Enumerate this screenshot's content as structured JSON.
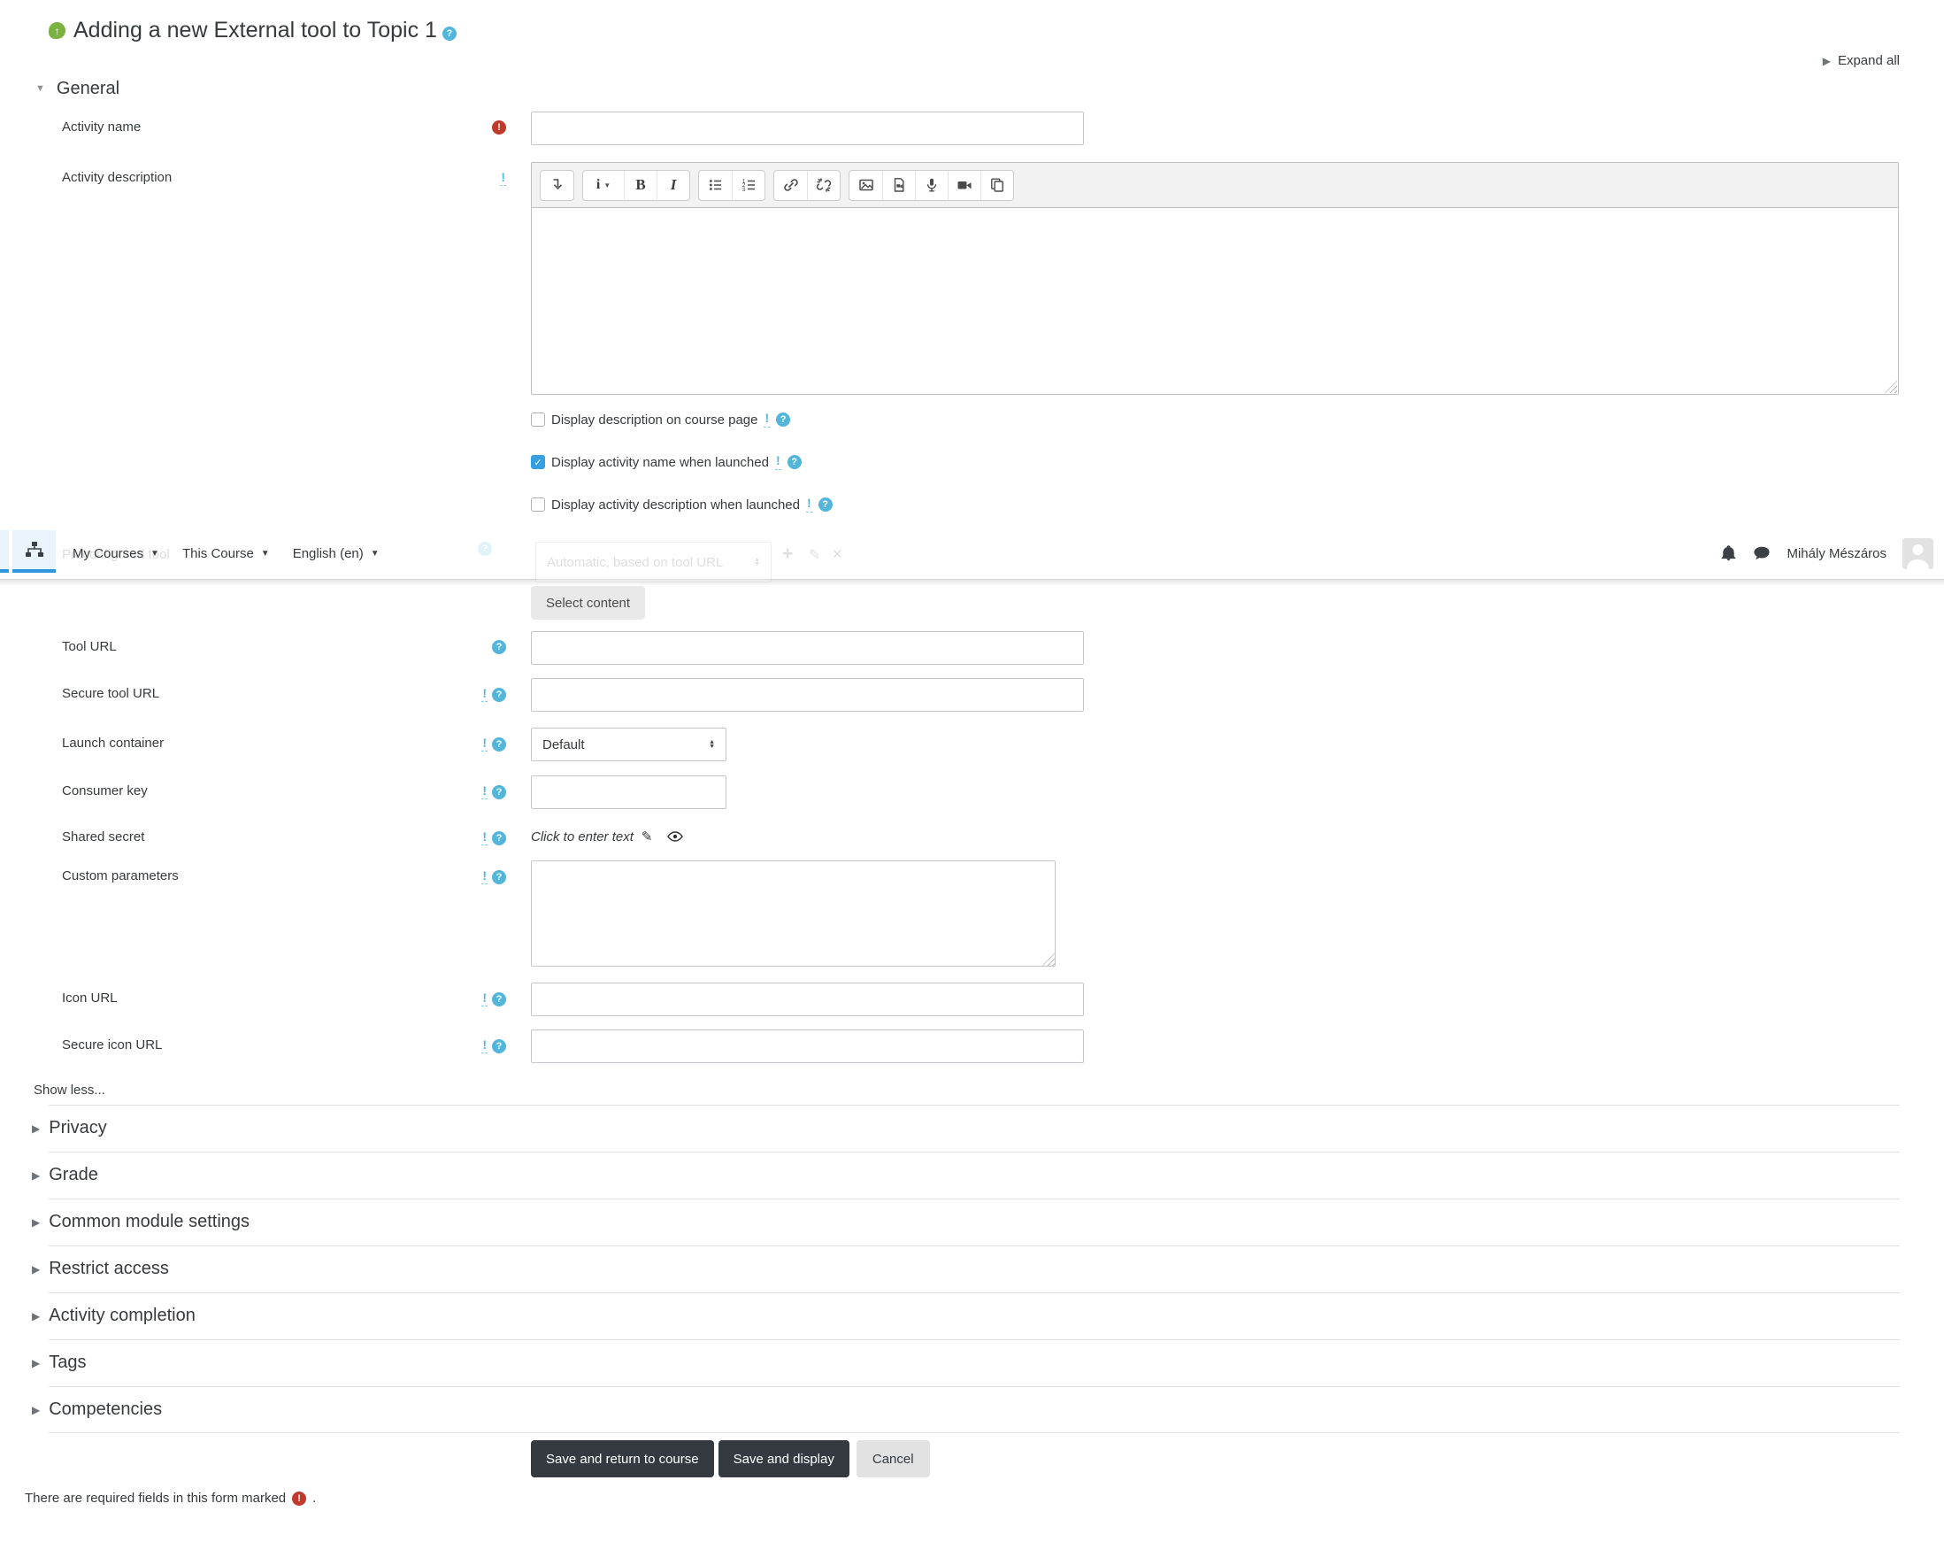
{
  "page": {
    "title": "Adding a new External tool to Topic 1",
    "expand_all": "Expand all",
    "footer_note": "There are required fields in this form marked",
    "footer_note_suffix": "."
  },
  "navbar": {
    "menus": [
      {
        "label": "My Courses"
      },
      {
        "label": "This Course"
      },
      {
        "label": "English (en)"
      }
    ],
    "user_name": "Mihály Mészáros",
    "icons": [
      "sitemap-icon",
      "bell-icon",
      "messages-icon",
      "avatar"
    ]
  },
  "ghost_row": {
    "label": "Preconfigured tool",
    "select_value": "Automatic, based on tool URL",
    "icons": [
      "add-icon",
      "edit-icon",
      "delete-icon"
    ]
  },
  "sections": {
    "general": "General",
    "collapsed": [
      "Privacy",
      "Grade",
      "Common module settings",
      "Restrict access",
      "Activity completion",
      "Tags",
      "Competencies"
    ]
  },
  "fields": {
    "activity_name": {
      "label": "Activity name",
      "value": ""
    },
    "activity_description": {
      "label": "Activity description",
      "value": ""
    },
    "select_content": "Select content",
    "tool_url": {
      "label": "Tool URL",
      "value": ""
    },
    "secure_tool_url": {
      "label": "Secure tool URL",
      "value": ""
    },
    "launch_container": {
      "label": "Launch container",
      "value": "Default"
    },
    "consumer_key": {
      "label": "Consumer key",
      "value": ""
    },
    "shared_secret": {
      "label": "Shared secret",
      "value": "Click to enter text"
    },
    "custom_parameters": {
      "label": "Custom parameters",
      "value": ""
    },
    "icon_url": {
      "label": "Icon URL",
      "value": ""
    },
    "secure_icon_url": {
      "label": "Secure icon URL",
      "value": ""
    },
    "show_less": "Show less..."
  },
  "checkboxes": [
    {
      "label": "Display description on course page",
      "checked": false
    },
    {
      "label": "Display activity name when launched",
      "checked": true
    },
    {
      "label": "Display activity description when launched",
      "checked": false
    }
  ],
  "editor_toolbar": [
    "collapse-toolbar",
    "paragraph-styles",
    "bold",
    "italic",
    "unordered-list",
    "ordered-list",
    "link",
    "unlink",
    "insert-image",
    "insert-media",
    "record-audio",
    "record-video",
    "manage-files"
  ],
  "buttons": {
    "save_return": "Save and return to course",
    "save_display": "Save and display",
    "cancel": "Cancel"
  },
  "colors": {
    "accent": "#2f96e0",
    "info": "#52b5da",
    "required": "#c0392b",
    "dark_button": "#343a40"
  }
}
